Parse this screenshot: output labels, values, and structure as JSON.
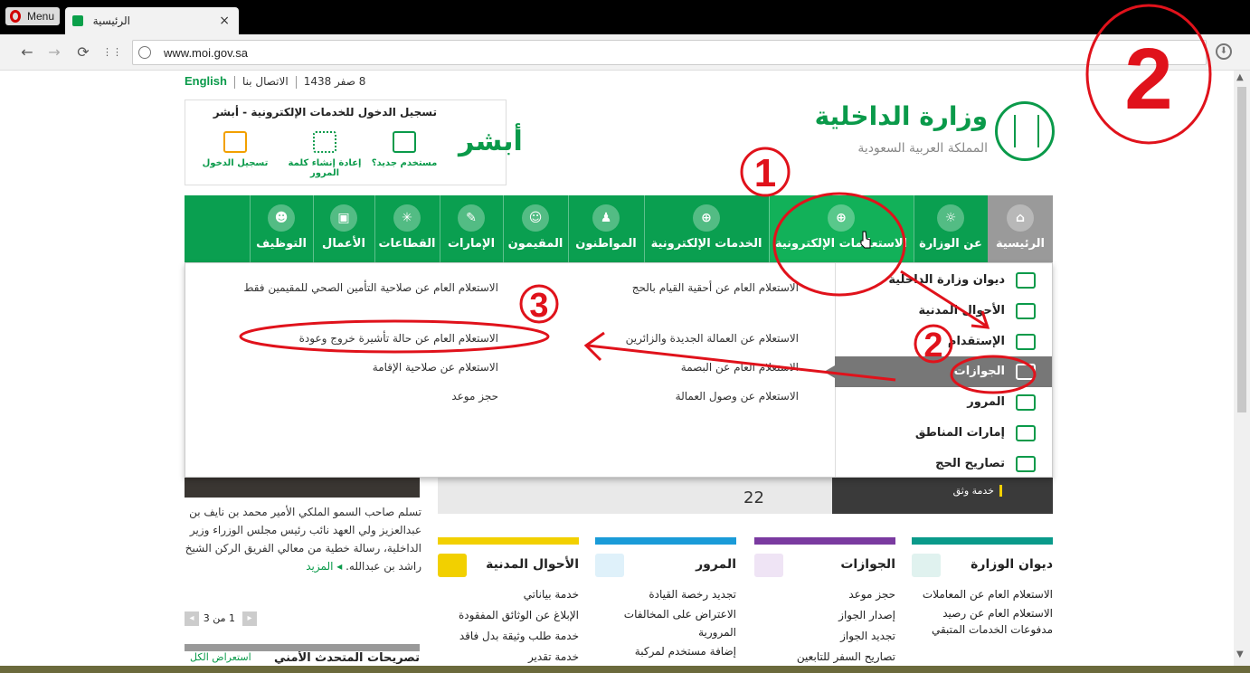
{
  "browser": {
    "menu_label": "Menu",
    "tab_title": "الرئيسية",
    "tab_close": "×",
    "url": "www.moi.gov.sa",
    "back": "←",
    "forward": "→",
    "reload": "⟳",
    "grid": "⋮⋮",
    "download": "⬇"
  },
  "topinfo": {
    "date": "8 صفر 1438",
    "contact": "الاتصال بنا",
    "english": "English"
  },
  "logo": {
    "title": "وزارة الداخلية",
    "subtitle": "المملكة العربية السعودية"
  },
  "absher": {
    "heading": "تسجيل الدخول للخدمات الإلكترونية - أبشر",
    "brand": "أبشر",
    "items": [
      {
        "label": "مستخدم جديد؟",
        "icon": "new-user-icon"
      },
      {
        "label": "إعادة إنشاء كلمة المرور",
        "icon": "reset-password-icon"
      },
      {
        "label": "تسجيل الدخول",
        "icon": "login-icon"
      }
    ]
  },
  "nav": [
    {
      "label": "الرئيسية",
      "icon": "home-icon"
    },
    {
      "label": "عن الوزارة",
      "icon": "ministry-emblem-icon"
    },
    {
      "label": "الاستعلامات الإلكترونية",
      "icon": "inquiries-globe-icon"
    },
    {
      "label": "الخدمات الإلكترونية",
      "icon": "globe-icon"
    },
    {
      "label": "المواطنون",
      "icon": "citizen-icon"
    },
    {
      "label": "المقيمون",
      "icon": "residents-icon"
    },
    {
      "label": "الإمارات",
      "icon": "emirates-icon"
    },
    {
      "label": "القطاعات",
      "icon": "sectors-icon"
    },
    {
      "label": "الأعمال",
      "icon": "business-icon"
    },
    {
      "label": "التوظيف",
      "icon": "employment-icon"
    }
  ],
  "dropdown": {
    "side": [
      {
        "label": "ديوان وزارة الداخلية",
        "icon": "ministry-office-icon"
      },
      {
        "label": "الأحوال المدنية",
        "icon": "civil-affairs-icon"
      },
      {
        "label": "الإستقدام",
        "icon": "recruitment-icon"
      },
      {
        "label": "الجوازات",
        "icon": "passports-icon"
      },
      {
        "label": "المرور",
        "icon": "traffic-icon"
      },
      {
        "label": "إمارات المناطق",
        "icon": "emirates-regions-icon"
      },
      {
        "label": "تصاريح الحج",
        "icon": "hajj-permits-icon"
      }
    ],
    "col_right": [
      "الاستعلام العام عن أحقية القيام بالحج",
      "الاستعلام عن العمالة الجديدة والزائرين",
      "الاستعلام العام عن البصمة",
      "الاستعلام عن وصول العمالة"
    ],
    "col_left": [
      "الاستعلام العام عن صلاحية التأمين الصحي للمقيمين فقط",
      "الاستعلام العام عن حالة تأشيرة خروج وعودة",
      "الاستعلام عن صلاحية الإقامة",
      "حجز موعد"
    ]
  },
  "hero": {
    "number": "22",
    "caption": "خدمة وثق"
  },
  "news": {
    "text": "تسلم صاحب السمو الملكي الأمير محمد بن نايف بن عبدالعزيز ولي العهد نائب رئيس مجلس الوزراء وزير الداخلية، رسالة خطية من معالي الفريق الركن الشيخ راشد بن عبدالله.",
    "more": "المزيد",
    "pager": "1 من 3"
  },
  "news2": {
    "title": "تصريحات المتحدث الأمني",
    "link": "استعراض الكل"
  },
  "columns": [
    {
      "title": "ديوان الوزارة",
      "color": "#0a9a8a",
      "icon": "ministry-office-icon",
      "items": [
        "الاستعلام العام عن المعاملات",
        "الاستعلام العام عن رصيد مدفوعات الخدمات المتبقي"
      ]
    },
    {
      "title": "الجوازات",
      "color": "#7a3aa0",
      "icon": "passports-icon",
      "items": [
        "حجز موعد",
        "إصدار الجواز",
        "تجديد الجواز",
        "تصاريح السفر للتابعين"
      ]
    },
    {
      "title": "المرور",
      "color": "#1a9bd8",
      "icon": "car-icon",
      "items": [
        "تجديد رخصة القيادة",
        "الاعتراض على المخالفات المرورية",
        "إضافة مستخدم لمركبة"
      ]
    },
    {
      "title": "الأحوال المدنية",
      "color": "#f2d000",
      "icon": "id-card-icon",
      "items": [
        "خدمة بياناتي",
        "الإبلاغ عن الوثائق المفقودة",
        "خدمة طلب وثيقة بدل فاقد",
        "خدمة تقدير"
      ]
    }
  ],
  "annotations": {
    "n1": "1",
    "n2a": "2",
    "n2b": "2",
    "n3": "3"
  },
  "colors": {
    "green": "#0a9f50",
    "annotation_red": "#e0121b"
  }
}
